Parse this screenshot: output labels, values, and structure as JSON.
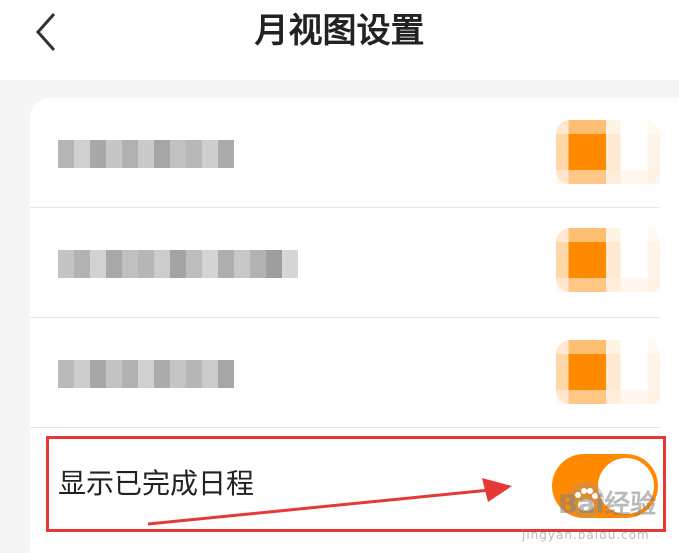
{
  "header": {
    "title": "月视图设置"
  },
  "settings": {
    "rows": [
      {
        "label": "",
        "enabled": true
      },
      {
        "label": "",
        "enabled": true
      },
      {
        "label": "",
        "enabled": true
      },
      {
        "label": "显示已完成日程",
        "enabled": true
      }
    ]
  },
  "colors": {
    "accent": "#ff8a00",
    "annotation": "#e53935"
  },
  "watermark": {
    "brand": "Bai经验",
    "url": "jingyan.baidu.com"
  },
  "icons": {
    "back": "chevron-left-icon",
    "watermark": "baidu-paw-icon"
  }
}
